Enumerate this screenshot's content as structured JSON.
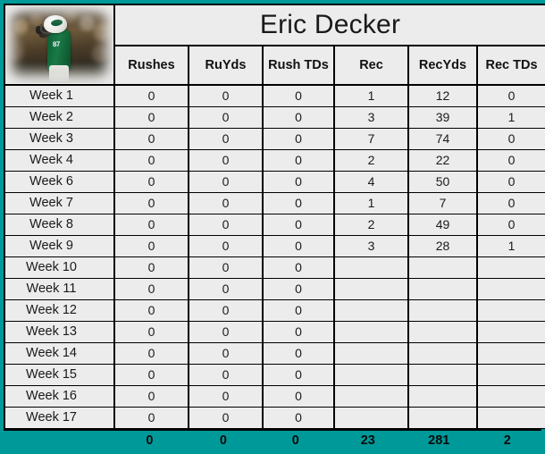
{
  "player": {
    "name": "Eric Decker",
    "photo_alt": "player-photo",
    "jersey_number": "87"
  },
  "table": {
    "row_label_header": "",
    "columns": [
      "Rushes",
      "RuYds",
      "Rush TDs",
      "Rec",
      "RecYds",
      "Rec TDs"
    ],
    "rows": [
      {
        "label": "Week 1",
        "values": [
          "0",
          "0",
          "0",
          "1",
          "12",
          "0"
        ]
      },
      {
        "label": "Week 2",
        "values": [
          "0",
          "0",
          "0",
          "3",
          "39",
          "1"
        ]
      },
      {
        "label": "Week 3",
        "values": [
          "0",
          "0",
          "0",
          "7",
          "74",
          "0"
        ]
      },
      {
        "label": "Week 4",
        "values": [
          "0",
          "0",
          "0",
          "2",
          "22",
          "0"
        ]
      },
      {
        "label": "Week 6",
        "values": [
          "0",
          "0",
          "0",
          "4",
          "50",
          "0"
        ]
      },
      {
        "label": "Week 7",
        "values": [
          "0",
          "0",
          "0",
          "1",
          "7",
          "0"
        ]
      },
      {
        "label": "Week 8",
        "values": [
          "0",
          "0",
          "0",
          "2",
          "49",
          "0"
        ]
      },
      {
        "label": "Week 9",
        "values": [
          "0",
          "0",
          "0",
          "3",
          "28",
          "1"
        ]
      },
      {
        "label": "Week 10",
        "values": [
          "0",
          "0",
          "0",
          "",
          "",
          ""
        ]
      },
      {
        "label": "Week 11",
        "values": [
          "0",
          "0",
          "0",
          "",
          "",
          ""
        ]
      },
      {
        "label": "Week 12",
        "values": [
          "0",
          "0",
          "0",
          "",
          "",
          ""
        ]
      },
      {
        "label": "Week 13",
        "values": [
          "0",
          "0",
          "0",
          "",
          "",
          ""
        ]
      },
      {
        "label": "Week 14",
        "values": [
          "0",
          "0",
          "0",
          "",
          "",
          ""
        ]
      },
      {
        "label": "Week 15",
        "values": [
          "0",
          "0",
          "0",
          "",
          "",
          ""
        ]
      },
      {
        "label": "Week 16",
        "values": [
          "0",
          "0",
          "0",
          "",
          "",
          ""
        ]
      },
      {
        "label": "Week 17",
        "values": [
          "0",
          "0",
          "0",
          "",
          "",
          ""
        ]
      }
    ],
    "totals": {
      "label": "",
      "values": [
        "0",
        "0",
        "0",
        "23",
        "281",
        "2"
      ]
    }
  },
  "colors": {
    "accent": "#009999",
    "cell_background": "#ececec",
    "border": "#000000",
    "text": "#1a1a1a"
  }
}
